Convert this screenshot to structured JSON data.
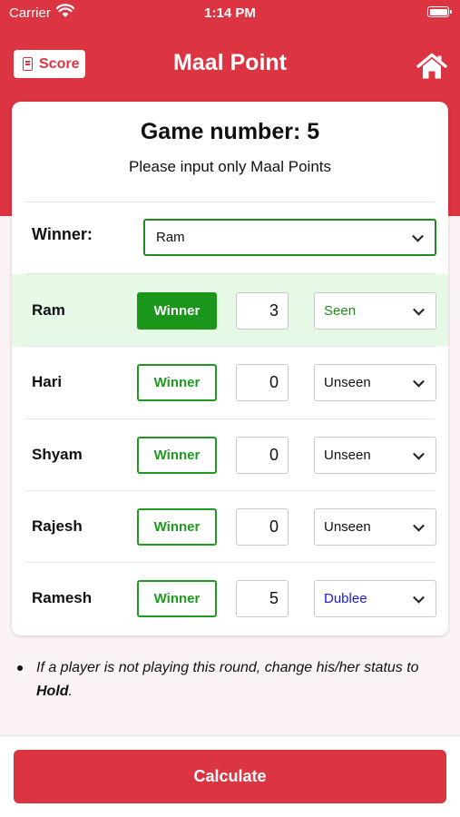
{
  "status_bar": {
    "carrier": "Carrier",
    "time": "1:14 PM"
  },
  "header": {
    "score_label": "Score",
    "title": "Maal Point"
  },
  "card": {
    "game_title": "Game number: 5",
    "subtitle": "Please input only Maal Points",
    "winner_label": "Winner:",
    "winner_value": "Ram"
  },
  "players": [
    {
      "name": "Ram",
      "button": "Winner",
      "points": "3",
      "status": "Seen"
    },
    {
      "name": "Hari",
      "button": "Winner",
      "points": "0",
      "status": "Unseen"
    },
    {
      "name": "Shyam",
      "button": "Winner",
      "points": "0",
      "status": "Unseen"
    },
    {
      "name": "Rajesh",
      "button": "Winner",
      "points": "0",
      "status": "Unseen"
    },
    {
      "name": "Ramesh",
      "button": "Winner",
      "points": "5",
      "status": "Dublee"
    }
  ],
  "note": {
    "text": "If a player is not playing this round, change his/her status to ",
    "bold": "Hold",
    "end": "."
  },
  "calculate_label": "Calculate",
  "colors": {
    "brand_red": "#dd3442",
    "winner_green": "#1a961a",
    "seen_green": "#1e8c1e",
    "dublee_blue": "#1a1ad6",
    "active_row": "#e6f9e6"
  }
}
